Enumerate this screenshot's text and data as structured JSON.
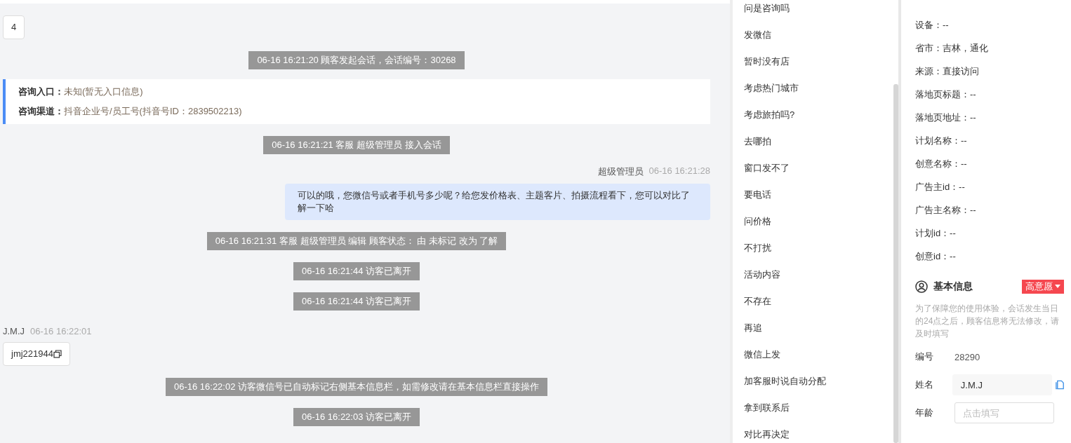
{
  "chat": {
    "messages": [
      {
        "kind": "visitor",
        "text": "4"
      },
      {
        "kind": "system",
        "text": "06-16 16:21:20 顾客发起会话，会话编号：30268"
      },
      {
        "kind": "entry_card",
        "rows": [
          {
            "label": "咨询入口：",
            "value": "未知(暂无入口信息)"
          },
          {
            "label": "咨询渠道：",
            "value": "抖音企业号/员工号(抖音号ID：2839502213)"
          }
        ]
      },
      {
        "kind": "system",
        "text": "06-16 16:21:21 客服 超级管理员 接入会话"
      },
      {
        "kind": "agent",
        "name": "超级管理员",
        "time": "06-16 16:21:28",
        "text": "可以的哦，您微信号或者手机号多少呢？给您发价格表、主题客片、拍摄流程看下，您可以对比了解一下哈"
      },
      {
        "kind": "system",
        "text": "06-16 16:21:31 客服 超级管理员 编辑 顾客状态： 由 未标记 改为 了解"
      },
      {
        "kind": "system",
        "text": "06-16 16:21:44 访客已离开"
      },
      {
        "kind": "system",
        "text": "06-16 16:21:44 访客已离开"
      },
      {
        "kind": "visitor",
        "name": "J.M.J",
        "time": "06-16 16:22:01",
        "text": "jmj221944",
        "copyable": true
      },
      {
        "kind": "system",
        "text": "06-16 16:22:02 访客微信号已自动标记右侧基本信息栏，如需修改请在基本信息栏直接操作"
      },
      {
        "kind": "system",
        "text": "06-16 16:22:03 访客已离开"
      }
    ]
  },
  "quick_replies": [
    "问是咨询吗",
    "发微信",
    "暂时没有店",
    "考虑热门城市",
    "考虑旅拍吗?",
    "去哪拍",
    "窗口发不了",
    "要电话",
    "问价格",
    "不打扰",
    "活动内容",
    "不存在",
    "再追",
    "微信上发",
    "加客服时说自动分配",
    "拿到联系后",
    "对比再决定"
  ],
  "visitor_info": {
    "fields": [
      "设备：--",
      "省市：吉林，通化",
      "来源：直接访问",
      "落地页标题：--",
      "落地页地址：--",
      "计划名称：--",
      "创意名称：--",
      "广告主id：--",
      "广告主名称：--",
      "计划id：--",
      "创意id：--"
    ]
  },
  "basic_info": {
    "title": "基本信息",
    "intent_tag": "高意愿",
    "note": "为了保障您的使用体验，会话发生当日的24点之后，顾客信息将无法修改，请及时填写",
    "fields": [
      {
        "kind": "text",
        "label": "编号",
        "value": "28290"
      },
      {
        "kind": "input",
        "label": "姓名",
        "value": "J.M.J",
        "copyable": true
      },
      {
        "kind": "input",
        "label": "年龄",
        "placeholder": "点击填写"
      }
    ]
  }
}
